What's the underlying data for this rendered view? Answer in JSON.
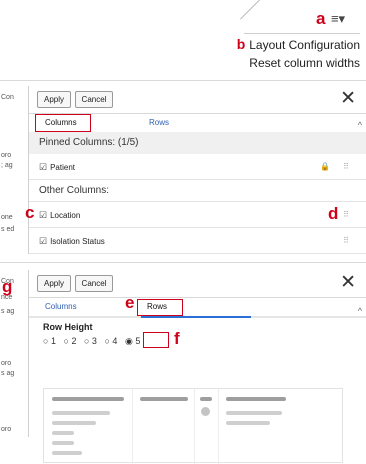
{
  "markers": {
    "a": "a",
    "b": "b",
    "c": "c",
    "d": "d",
    "e": "e",
    "f": "f",
    "g": "g"
  },
  "menu": {
    "icon": "≡▾",
    "items": [
      "Layout Configuration",
      "Reset column widths"
    ]
  },
  "background_fragments": {
    "panel2": [
      "Con",
      "oro",
      "; ag",
      "one",
      "s ed"
    ],
    "panel3": [
      "Con",
      "nce",
      "s ag",
      "oro",
      "s ag",
      "oro"
    ]
  },
  "toolbar": {
    "apply_label": "Apply",
    "cancel_label": "Cancel",
    "close_icon": "✕"
  },
  "tabs": {
    "columns_label": "Columns",
    "rows_label": "Rows"
  },
  "pinned": {
    "header": "Pinned Columns: (1/5)",
    "items": [
      {
        "label": "Patient",
        "checked": true,
        "locked": true
      }
    ]
  },
  "other": {
    "header": "Other Columns:",
    "items": [
      {
        "label": "Location",
        "checked": true
      },
      {
        "label": "Isolation Status",
        "checked": true
      }
    ]
  },
  "rows_panel": {
    "row_height_label": "Row Height",
    "options": [
      "1",
      "2",
      "3",
      "4",
      "5"
    ],
    "selected": "5"
  },
  "icons": {
    "checkbox": "☑",
    "drag": "⠿",
    "lock": "🔒",
    "radio_off": "○",
    "radio_on": "◉",
    "scroll_up": "^"
  },
  "colors": {
    "marker": "#d0021b",
    "tab_link": "#3060b0",
    "tab_underline": "#2b6ed6"
  }
}
